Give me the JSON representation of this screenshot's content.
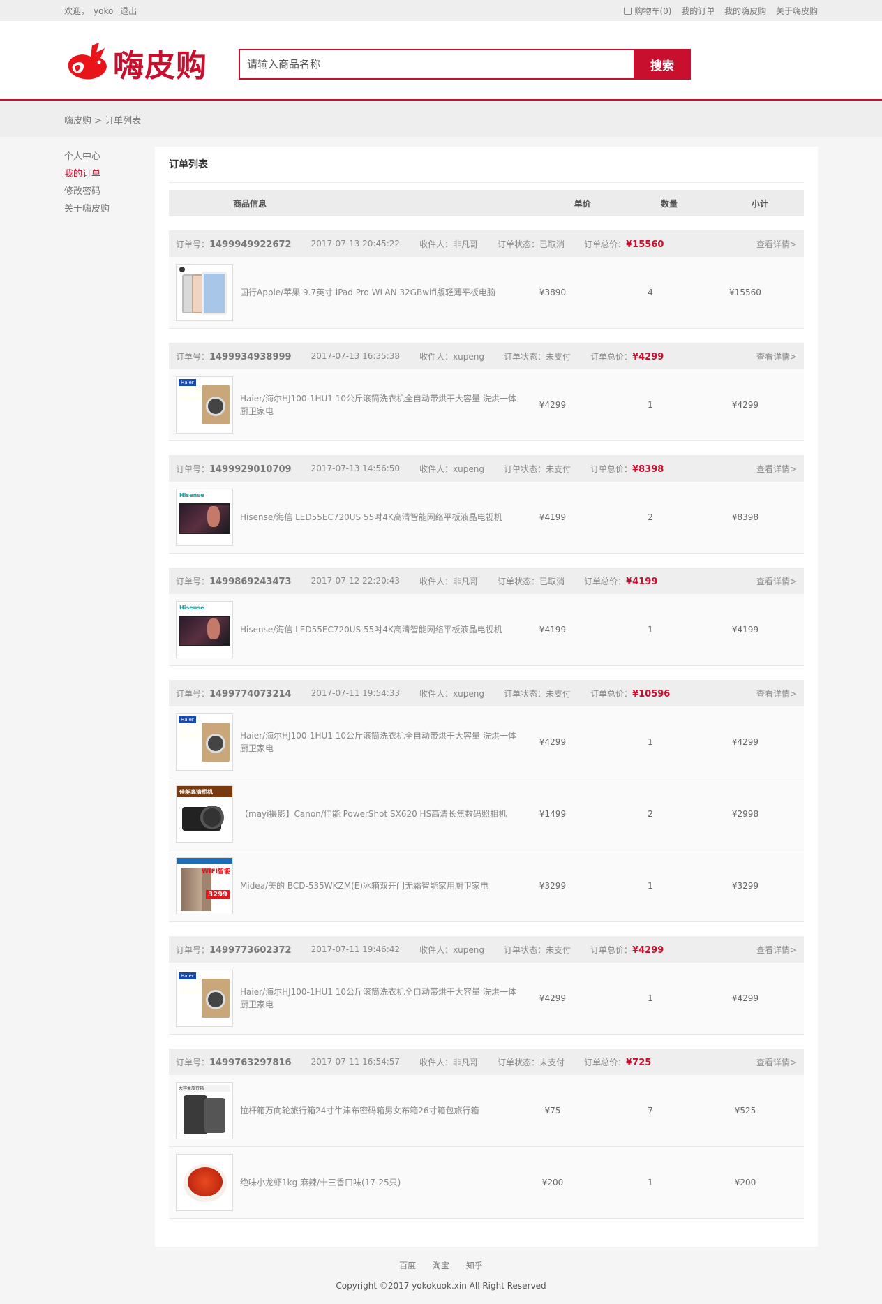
{
  "topbar": {
    "welcome": "欢迎，",
    "username": "yoko",
    "logout": "退出",
    "cart": "购物车(0)",
    "my_orders": "我的订单",
    "my_account": "我的嗨皮购",
    "about": "关于嗨皮购"
  },
  "header": {
    "logo_text": "嗨皮购",
    "search_placeholder": "请输入商品名称",
    "search_button": "搜索",
    "brand_color": "#c8102e"
  },
  "breadcrumb": "嗨皮购 > 订单列表",
  "sidebar": {
    "items": [
      {
        "label": "个人中心"
      },
      {
        "label": "我的订单"
      },
      {
        "label": "修改密码"
      },
      {
        "label": "关于嗨皮购"
      }
    ]
  },
  "panel": {
    "title": "订单列表",
    "columns": [
      "商品信息",
      "单价",
      "数量",
      "小计"
    ]
  },
  "labels": {
    "order_no": "订单号：",
    "receiver": "收件人：",
    "status": "订单状态：",
    "total": "订单总价：",
    "detail": "查看详情>"
  },
  "orders": [
    {
      "no": "1499949922672",
      "time": "2017-07-13 20:45:22",
      "receiver": "非凡哥",
      "status": "已取消",
      "total": "¥15560",
      "items": [
        {
          "img": "ipad",
          "name": "国行Apple/苹果 9.7英寸 iPad Pro WLAN 32GBwifi版轻薄平板电脑",
          "price": "¥3890",
          "qty": "4",
          "sub": "¥15560"
        }
      ]
    },
    {
      "no": "1499934938999",
      "time": "2017-07-13 16:35:38",
      "receiver": "xupeng",
      "status": "未支付",
      "total": "¥4299",
      "items": [
        {
          "img": "washer",
          "name": "Haier/海尔HJ100-1HU1 10公斤滚筒洗衣机全自动带烘干大容量 洗烘一体 厨卫家电",
          "price": "¥4299",
          "qty": "1",
          "sub": "¥4299"
        }
      ]
    },
    {
      "no": "1499929010709",
      "time": "2017-07-13 14:56:50",
      "receiver": "xupeng",
      "status": "未支付",
      "total": "¥8398",
      "items": [
        {
          "img": "tv",
          "name": "Hisense/海信 LED55EC720US 55吋4K高清智能网络平板液晶电视机",
          "price": "¥4199",
          "qty": "2",
          "sub": "¥8398"
        }
      ]
    },
    {
      "no": "1499869243473",
      "time": "2017-07-12 22:20:43",
      "receiver": "非凡哥",
      "status": "已取消",
      "total": "¥4199",
      "items": [
        {
          "img": "tv",
          "name": "Hisense/海信 LED55EC720US 55吋4K高清智能网络平板液晶电视机",
          "price": "¥4199",
          "qty": "1",
          "sub": "¥4199"
        }
      ]
    },
    {
      "no": "1499774073214",
      "time": "2017-07-11 19:54:33",
      "receiver": "xupeng",
      "status": "未支付",
      "total": "¥10596",
      "items": [
        {
          "img": "washer",
          "name": "Haier/海尔HJ100-1HU1 10公斤滚筒洗衣机全自动带烘干大容量 洗烘一体 厨卫家电",
          "price": "¥4299",
          "qty": "1",
          "sub": "¥4299"
        },
        {
          "img": "camera",
          "name": "【mayi摄影】Canon/佳能 PowerShot SX620 HS高清长焦数码照相机",
          "price": "¥1499",
          "qty": "2",
          "sub": "¥2998"
        },
        {
          "img": "fridge",
          "name": "Midea/美的 BCD-535WKZM(E)冰箱双开门无霜智能家用厨卫家电",
          "price": "¥3299",
          "qty": "1",
          "sub": "¥3299"
        }
      ]
    },
    {
      "no": "1499773602372",
      "time": "2017-07-11 19:46:42",
      "receiver": "xupeng",
      "status": "未支付",
      "total": "¥4299",
      "items": [
        {
          "img": "washer",
          "name": "Haier/海尔HJ100-1HU1 10公斤滚筒洗衣机全自动带烘干大容量 洗烘一体 厨卫家电",
          "price": "¥4299",
          "qty": "1",
          "sub": "¥4299"
        }
      ]
    },
    {
      "no": "1499763297816",
      "time": "2017-07-11 16:54:57",
      "receiver": "非凡哥",
      "status": "未支付",
      "total": "¥725",
      "items": [
        {
          "img": "luggage",
          "name": "拉杆箱万向轮旅行箱24寸牛津布密码箱男女布箱26寸箱包旅行箱",
          "price": "¥75",
          "qty": "7",
          "sub": "¥525"
        },
        {
          "img": "shrimp",
          "name": "绝味小龙虾1kg 麻辣/十三香口味(17-25只)",
          "price": "¥200",
          "qty": "1",
          "sub": "¥200"
        }
      ]
    }
  ],
  "thumb_text": {
    "washer_tag": "Haier",
    "washer_line1": "洗烘一体",
    "washer_line2": "精洗精烘",
    "washer_price": "4299",
    "tv_brand": "Hisense",
    "camera_title": "佳能高清相机",
    "fridge_wifi": "WIFI智能",
    "fridge_price": "3299",
    "luggage_hd": "大容量旅行箱"
  },
  "footer": {
    "links": [
      "百度",
      "淘宝",
      "知乎"
    ],
    "copyright": "Copyright ©2017 yokokuok.xin All Right Reserved"
  }
}
